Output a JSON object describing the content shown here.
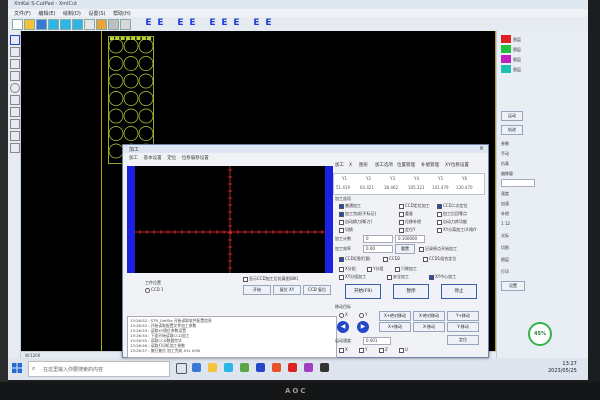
{
  "app": {
    "title": "XinKai S-CutPad - XmlCut"
  },
  "menu": [
    "文件(F)",
    "编辑(E)",
    "绘制(D)",
    "设置(S)",
    "帮助(H)"
  ],
  "toolbar": {
    "letters": [
      "E",
      "E",
      "E",
      "E",
      "E",
      "E",
      "E",
      "E",
      "E"
    ]
  },
  "colors": {
    "accent": "#1a3fd0",
    "plot_edge": "#1a22e0",
    "crosshair": "#ff3030",
    "workpiece": "#b8d63a",
    "guide_line": "#b8a000"
  },
  "status": {
    "left": "W:1200",
    "right": "Cut:0/0  B:0.0 mm  0.000  S:0000"
  },
  "right_panel": {
    "swatches": [
      {
        "color": "#e02020",
        "label": "图层"
      },
      {
        "color": "#20c040",
        "label": "图层"
      },
      {
        "color": "#c020c0",
        "label": "图层"
      },
      {
        "color": "#20c0b0",
        "label": "图层"
      }
    ],
    "items": [
      "运动",
      "轨迹",
      "参数",
      "手动",
      "仿真",
      "偏移量",
      "速度",
      "加速",
      "补偿",
      "1 12",
      "光标",
      "切割",
      "图层",
      "打印",
      "设置"
    ]
  },
  "dialog": {
    "title": "加工",
    "close": "×",
    "tabs": [
      "加工",
      "基本设置",
      "定位",
      "位移偏移设置"
    ],
    "right_tabs": [
      "加工",
      "X",
      "图形",
      "加工选项",
      "位置管理",
      "补偿管理",
      "XY位移设置"
    ],
    "coord_headers": [
      "Y1",
      "Y2",
      "Y3",
      "Y4",
      "Y5",
      "Y6"
    ],
    "coord_values": [
      "51.419",
      "63.421",
      "38.462",
      "105.321",
      "141.479",
      "130.470"
    ],
    "options_label": "加工选项",
    "options": [
      {
        "label": "普通加工",
        "checked": true
      },
      {
        "label": "CCD定位加工",
        "checked": false
      },
      {
        "label": "CCD二次定位",
        "checked": true
      },
      {
        "label": "加工完成(不标记)",
        "checked": true
      },
      {
        "label": "重复",
        "checked": false
      },
      {
        "label": "加工后回零点",
        "checked": false
      },
      {
        "label": "自动换刀(断刀)",
        "checked": false
      },
      {
        "label": "位移补偿",
        "checked": false
      },
      {
        "label": "自动刀库功能",
        "checked": false
      },
      {
        "label": "切换",
        "checked": false
      },
      {
        "label": "定位Y",
        "checked": false
      },
      {
        "label": "XY分离加工(X)和Y",
        "checked": false
      }
    ],
    "count_label": "加工计数",
    "count_value": "0",
    "count_total": "0.100000",
    "process_label": "加工效率",
    "process_value": "0.00",
    "process_btn": "重置",
    "options2": [
      {
        "label": "记录原点开始加工",
        "checked": false
      },
      {
        "label": "CCD切割打圆",
        "checked": true
      },
      {
        "label": "CCD2",
        "checked": false
      },
      {
        "label": "CCD1组合定位",
        "checked": false
      },
      {
        "label": "X分组",
        "checked": false
      },
      {
        "label": "Y分组",
        "checked": false
      },
      {
        "label": "只做加工",
        "checked": false
      },
      {
        "label": "XY分组加工",
        "checked": false
      },
      {
        "label": "安全加工",
        "checked": false
      },
      {
        "label": "XY中心加工",
        "checked": true
      }
    ],
    "big_buttons": [
      "开始(F9)",
      "暂停",
      "停止"
    ],
    "plot_checkbox": "显示CCD加工后仿真图(BK)",
    "plot_buttons": [
      "开始",
      "复位 XY",
      "CCD 复位"
    ],
    "position_label": "工件位置",
    "position_value": "CCD 1",
    "motion_label": "移动目标",
    "axes": [
      "X",
      "Y",
      "Z",
      "U"
    ],
    "move_buttons": [
      "X+绝对移动",
      "X-绝对移动",
      "X+移动",
      "X-移动",
      "Y+移动",
      "Y-移动"
    ],
    "speed_label": "运动速度",
    "speed_value": "0.001",
    "speed_btn": "定位",
    "bottom_checks": [
      "X",
      "Y",
      "Z",
      "U"
    ],
    "log": [
      "13:26:52 : STR_GetSts 开始读取软件配置信息",
      "13:26:53 : 开始读取配置文件加工参数",
      "13:26:53 : 读取XY限位参数设置",
      "13:26:54 : 下面开始读取CCD加工",
      "13:26:55 : 读取CCD数据完毕",
      "13:26:56 : 读取打印机加工参数",
      "13:26:57 : 复归复位 加工完成 XYL 0/90"
    ]
  },
  "taskbar": {
    "search_placeholder": "在这里输入你要搜索的内容",
    "time": "13:27",
    "date": "2023/05/25"
  },
  "progress": {
    "percent_text": "45%",
    "value": 45
  },
  "monitor": {
    "brand": "AOC"
  }
}
